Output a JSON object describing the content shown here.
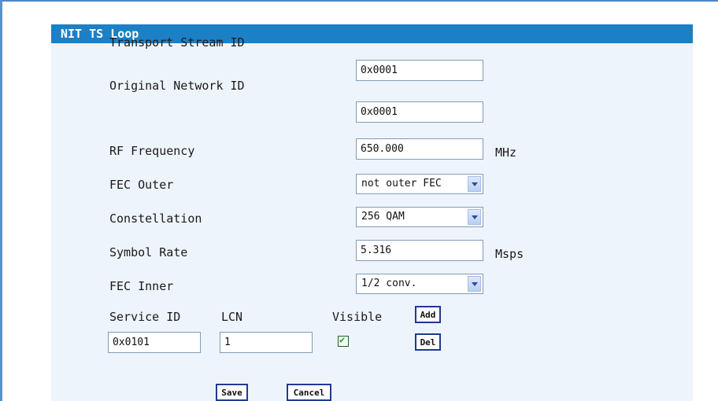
{
  "panel": {
    "title": "NIT TS Loop"
  },
  "fields": {
    "tsid": {
      "label": "Transport Stream ID",
      "value": "0x0001"
    },
    "onid": {
      "label": "Original Network ID",
      "value": "0x0001"
    },
    "rf": {
      "label": "RF Frequency",
      "value": "650.000",
      "unit": "MHz"
    },
    "fec_outer": {
      "label": "FEC Outer",
      "selected": "not outer FEC"
    },
    "constellation": {
      "label": "Constellation",
      "selected": "256 QAM"
    },
    "symbol_rate": {
      "label": "Symbol Rate",
      "value": "5.316",
      "unit": "Msps"
    },
    "fec_inner": {
      "label": "FEC Inner",
      "selected": "1/2 conv."
    }
  },
  "service": {
    "service_id_label": "Service ID",
    "lcn_label": "LCN",
    "visible_label": "Visible",
    "service_id_value": "0x0101",
    "lcn_value": "1",
    "visible_checked": true,
    "add_label": "Add",
    "del_label": "Del"
  },
  "actions": {
    "save_label": "Save",
    "cancel_label": "Cancel"
  },
  "colors": {
    "header": "#1b80c6",
    "panel_bg": "#eef4fb",
    "border_accent": "#5a8fd0"
  }
}
